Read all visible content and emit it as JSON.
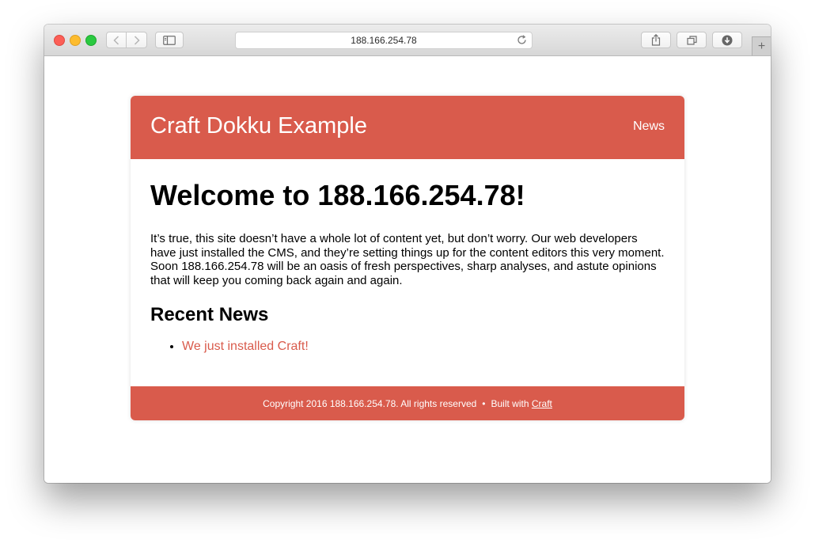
{
  "colors": {
    "accent": "#d95b4c"
  },
  "browser": {
    "url": "188.166.254.78",
    "toolbar_icons": [
      "back-arrow-icon",
      "forward-arrow-icon",
      "sidebar-icon",
      "reload-icon",
      "share-icon",
      "tabs-icon",
      "download-icon",
      "plus-icon"
    ]
  },
  "site": {
    "title": "Craft Dokku Example",
    "nav": {
      "news_label": "News"
    },
    "main": {
      "heading": "Welcome to 188.166.254.78!",
      "intro": "It’s true, this site doesn’t have a whole lot of content yet, but don’t worry. Our web developers have just installed the CMS, and they’re setting things up for the content editors this very moment. Soon 188.166.254.78 will be an oasis of fresh perspectives, sharp analyses, and astute opinions that will keep you coming back again and again.",
      "recent_news_heading": "Recent News",
      "news_items": [
        {
          "title": "We just installed Craft!"
        }
      ]
    },
    "footer": {
      "copyright": "Copyright 2016 188.166.254.78. All rights reserved",
      "separator": "•",
      "built_with": "Built with",
      "craft_link": "Craft"
    }
  }
}
